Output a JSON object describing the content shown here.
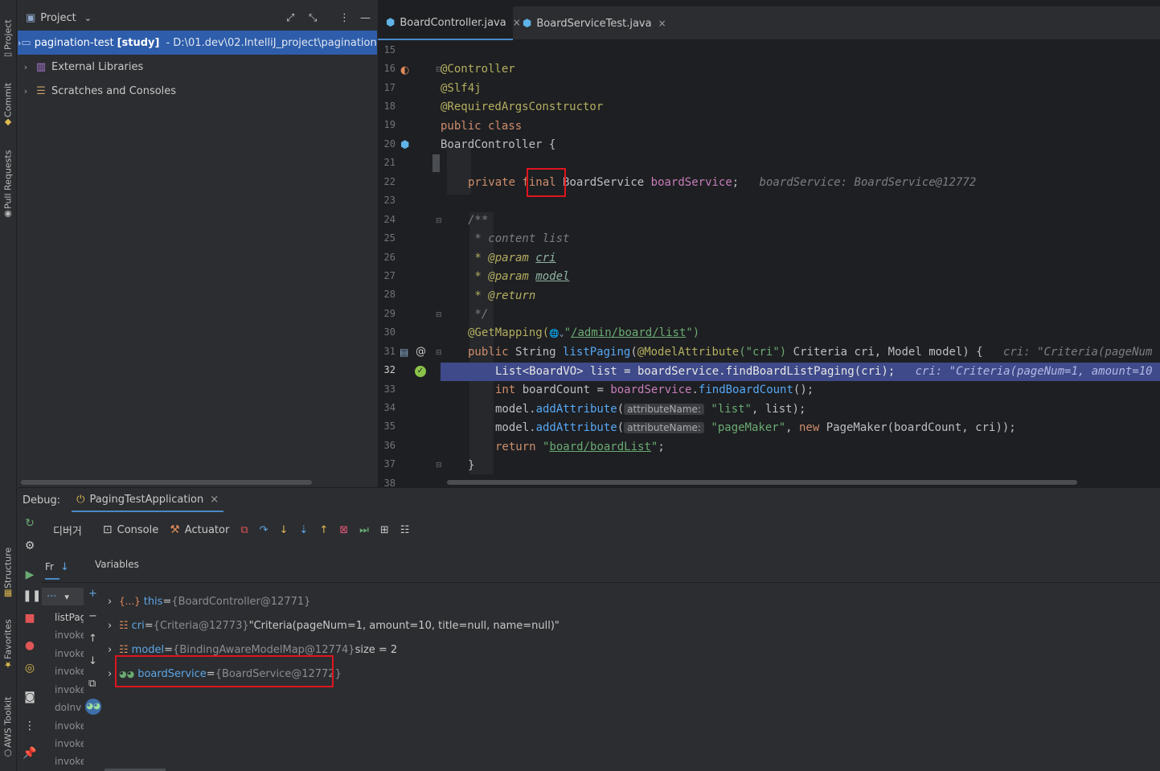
{
  "left_stripe": {
    "project_label": "Project",
    "commit_label": "Commit",
    "pull_requests_label": "Pull Requests",
    "structure_label": "Structure",
    "favorites_label": "Favorites",
    "aws_toolkit_label": "AWS Toolkit"
  },
  "project": {
    "header_label": "Project",
    "tree": [
      {
        "name": "pagination-test",
        "tag": "[study]",
        "path": " - D:\\01.dev\\02.IntelliJ_project\\pagination-te"
      },
      {
        "name": "External Libraries"
      },
      {
        "name": "Scratches and Consoles"
      }
    ]
  },
  "editor": {
    "tabs": [
      {
        "label": "BoardController.java",
        "close": "×"
      },
      {
        "label": "BoardServiceTest.java",
        "close": "×"
      }
    ],
    "line_numbers": [
      "15",
      "16",
      "17",
      "18",
      "19",
      "20",
      "21",
      "22",
      "23",
      "24",
      "25",
      "26",
      "27",
      "28",
      "29",
      "30",
      "31",
      "32",
      "33",
      "34",
      "35",
      "36",
      "37",
      "38"
    ],
    "code": {
      "l16": "@Controller",
      "l17": "@Slf4j",
      "l18": "@RequiredArgsConstructor",
      "l19_kw": "public class",
      "l20": "BoardController {",
      "l22_kw1": "private",
      "l22_final": "final",
      "l22_type": "BoardService",
      "l22_field": "boardService",
      "l22_semi": ";",
      "l22_hint": "boardService: BoardService@12772",
      "l24": "/**",
      "l25": " * content list",
      "l26_tag": " * @param",
      "l26_arg": "cri",
      "l27_tag": " * @param",
      "l27_arg": "model",
      "l28_tag": " * @return",
      "l29": " */",
      "l30_ann": "@GetMapping(",
      "l30_glob": "🌐⌄",
      "l30_q1": "\"",
      "l30_url": "/admin/board/list",
      "l30_q2": "\")",
      "l31_kw": "public",
      "l31_type": "String",
      "l31_meth": "listPaging",
      "l31_open": "(",
      "l31_ann": "@ModelAttribute",
      "l31_str": "(\"cri\")",
      "l31_rest": " Criteria cri, Model model) {",
      "l31_hint": "cri: \"Criteria(pageNum",
      "l32_code": "List<BoardVO> list = boardService.findBoardListPaging(cri);",
      "l32_hint": "cri: \"Criteria(pageNum=1, amount=10",
      "l33_kw": "int",
      "l33_var": "boardCount = ",
      "l33_field": "boardService",
      "l33_dot": ".",
      "l33_meth": "findBoardCount",
      "l33_end": "();",
      "l34_obj": "model.",
      "l34_meth": "addAttribute",
      "l34_open": "(",
      "l34_inlay": "attributeName:",
      "l34_str": "\"list\"",
      "l34_end": ", list);",
      "l35_obj": "model.",
      "l35_meth": "addAttribute",
      "l35_open": "(",
      "l35_inlay": "attributeName:",
      "l35_str": "\"pageMaker\"",
      "l35_mid": ", ",
      "l35_new": "new",
      "l35_cls": " PageMaker",
      "l35_end": "(boardCount, cri));",
      "l36_kw": "return",
      "l36_q1": "\"",
      "l36_str": "board/boardList",
      "l36_q2": "\"",
      "l36_semi": ";",
      "l37": "}"
    }
  },
  "debug": {
    "title": "Debug:",
    "session_tab": "PagingTestApplication",
    "session_close": "×",
    "toolbar": {
      "debugger_tab": "디버거",
      "console_tab": "Console",
      "actuator_tab": "Actuator"
    },
    "frames_header": "Fr",
    "variables_header": "Variables",
    "frames": [
      "listPag",
      "invoke",
      "invoke",
      "invoke",
      "invoke",
      "doInv",
      "invoke",
      "invoke",
      "invoke"
    ],
    "variables": [
      {
        "icon": "{...}",
        "name": "this",
        "eq": " = ",
        "type": "{BoardController@12771}",
        "value": ""
      },
      {
        "icon": "☷",
        "name": "cri",
        "eq": " = ",
        "type": "{Criteria@12773}",
        "value": " \"Criteria(pageNum=1, amount=10, title=null, name=null)\""
      },
      {
        "icon": "☷",
        "name": "model",
        "eq": " = ",
        "type": "{BindingAwareModelMap@12774}",
        "value": "  size = 2"
      },
      {
        "icon": "◕◕",
        "name": "boardService",
        "eq": " = ",
        "type": "{BoardService@12772}",
        "value": ""
      }
    ]
  }
}
